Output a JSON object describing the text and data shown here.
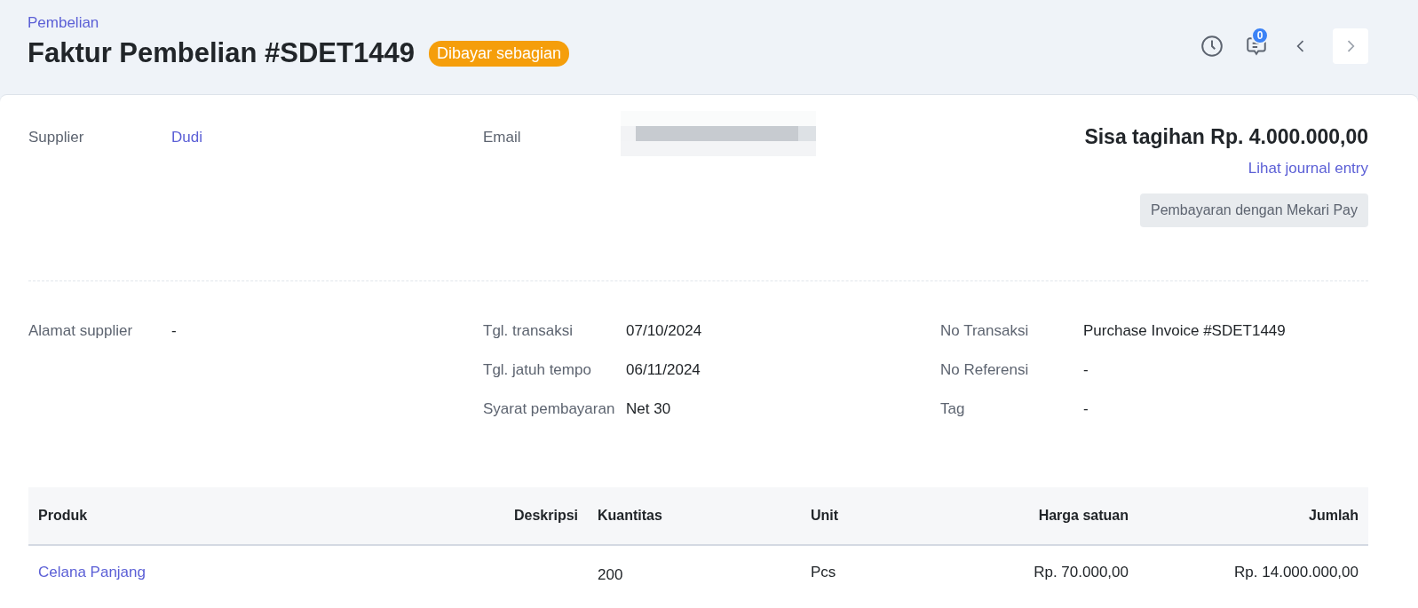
{
  "breadcrumb": "Pembelian",
  "title": "Faktur Pembelian #SDET1449",
  "status_badge": "Dibayar sebagian",
  "header_actions": {
    "comment_count": "0"
  },
  "supplier": {
    "label": "Supplier",
    "value": "Dudi"
  },
  "email": {
    "label": "Email"
  },
  "balance": {
    "text": "Sisa tagihan Rp. 4.000.000,00",
    "journal_link": "Lihat journal entry",
    "pay_button": "Pembayaran dengan Mekari Pay"
  },
  "address": {
    "label": "Alamat supplier",
    "value": "-"
  },
  "dates": [
    {
      "label": "Tgl. transaksi",
      "value": "07/10/2024"
    },
    {
      "label": "Tgl. jatuh tempo",
      "value": "06/11/2024"
    },
    {
      "label": "Syarat pembayaran",
      "value": "Net 30"
    }
  ],
  "refs": [
    {
      "label": "No Transaksi",
      "value": "Purchase Invoice #SDET1449"
    },
    {
      "label": "No Referensi",
      "value": "-"
    },
    {
      "label": "Tag",
      "value": "-"
    }
  ],
  "table": {
    "columns": [
      "Produk",
      "Deskripsi",
      "Kuantitas",
      "Unit",
      "Harga satuan",
      "Jumlah"
    ],
    "rows": [
      {
        "product": "Celana Panjang",
        "description": "",
        "quantity": "200",
        "unit": "Pcs",
        "unit_price": "Rp. 70.000,00",
        "amount": "Rp. 14.000.000,00"
      }
    ]
  }
}
